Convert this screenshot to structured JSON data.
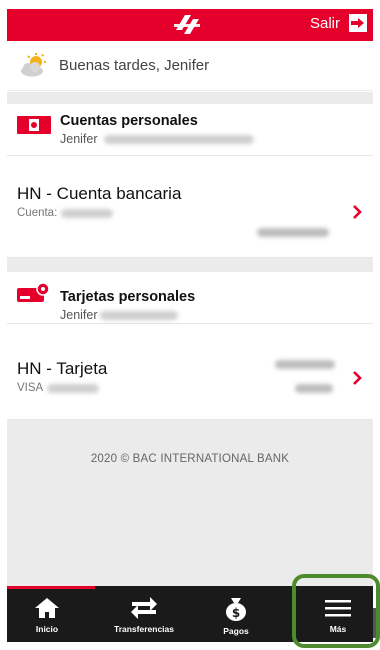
{
  "header": {
    "logout_label": "Salir"
  },
  "greeting": {
    "text": "Buenas tardes, Jenifer"
  },
  "sections": [
    {
      "title": "Cuentas personales",
      "owner_first": "Jenifer",
      "product": {
        "name": "HN - Cuenta bancaria",
        "detail_label": "Cuenta:"
      }
    },
    {
      "title": "Tarjetas personales",
      "owner_first": "Jenifer",
      "product": {
        "name": "HN - Tarjeta",
        "detail_label": "VISA"
      }
    }
  ],
  "footer": {
    "copyright": "2020 © BAC INTERNATIONAL BANK"
  },
  "nav": {
    "items": [
      {
        "label": "Inicio",
        "icon": "home-icon",
        "active": true
      },
      {
        "label": "Transferencias",
        "icon": "transfer-arrows-icon",
        "active": false
      },
      {
        "label": "Pagos",
        "icon": "money-bag-icon",
        "active": false
      },
      {
        "label": "Más",
        "icon": "menu-icon",
        "active": false
      }
    ]
  },
  "colors": {
    "brand": "#e4002b",
    "nav_bg": "#1a1a1a",
    "highlight": "#4e8b2f"
  }
}
